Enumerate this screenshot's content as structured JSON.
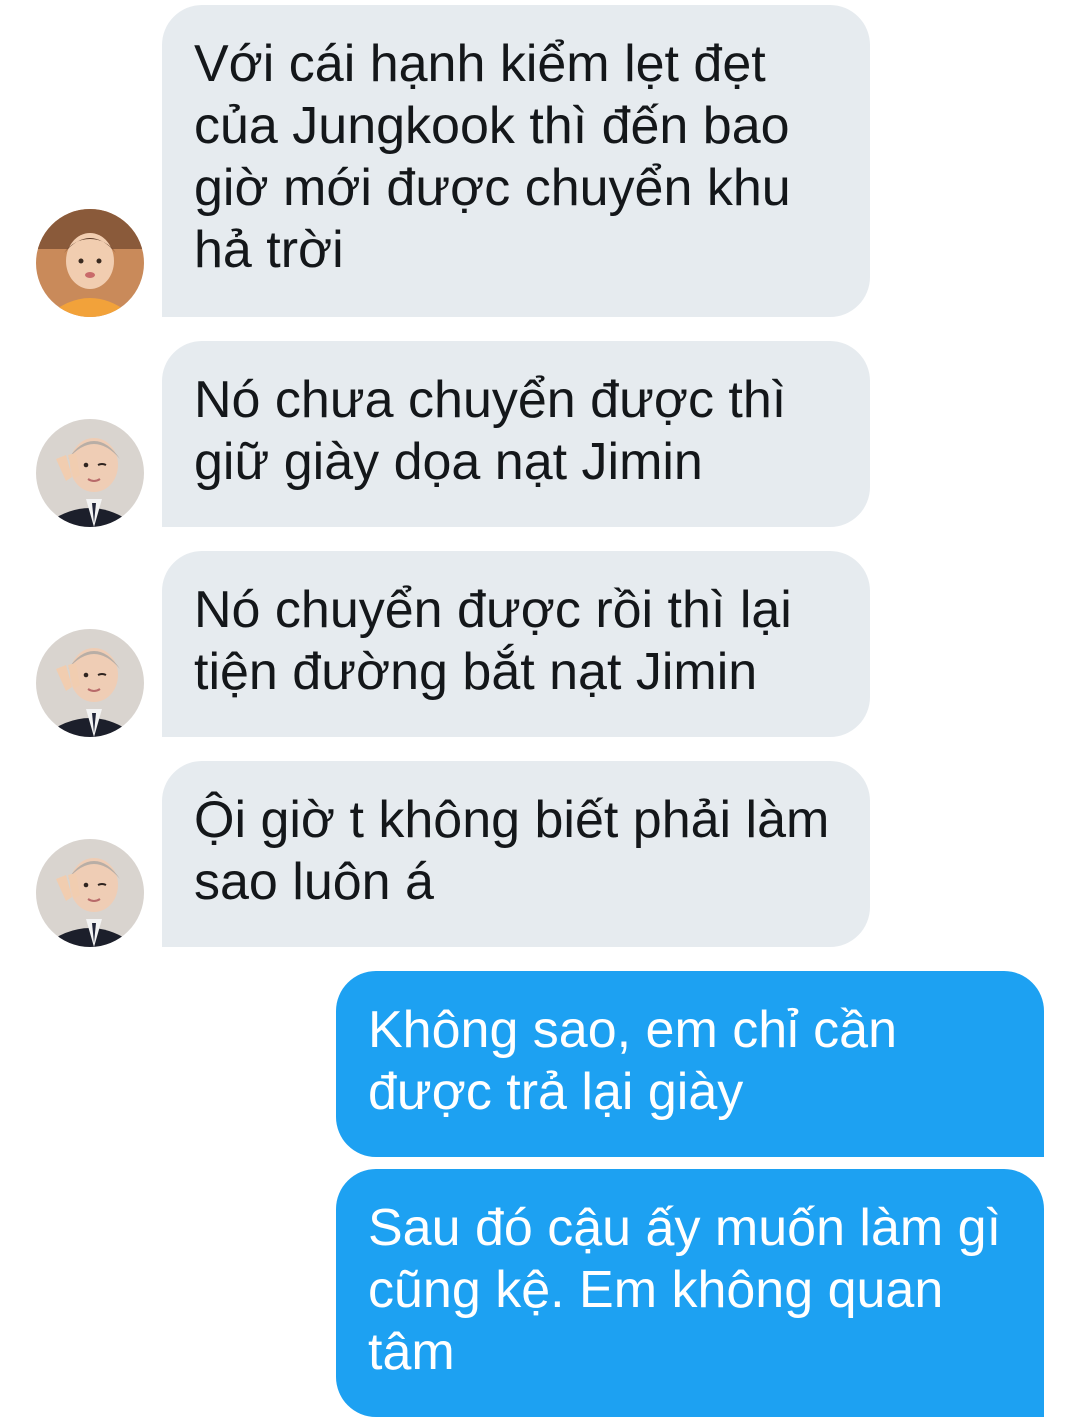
{
  "conversation": {
    "messages": [
      {
        "direction": "incoming",
        "sender_avatar": "avatar-orange-shirt",
        "text": "Với cái hạnh kiểm lẹt đẹt\ncủa Jungkook thì đến bao\ngiờ mới được chuyển khu\nhả trời"
      },
      {
        "direction": "incoming",
        "sender_avatar": "avatar-suit-peace-sign",
        "text": "Nó chưa chuyển được thì\ngiữ giày dọa nạt Jimin"
      },
      {
        "direction": "incoming",
        "sender_avatar": "avatar-suit-peace-sign",
        "text": "Nó chuyển được rồi thì lại\ntiện đường bắt nạt Jimin"
      },
      {
        "direction": "incoming",
        "sender_avatar": "avatar-suit-peace-sign",
        "text": "Ội giờ t không biết phải làm\nsao luôn á"
      },
      {
        "direction": "outgoing",
        "text": "Không sao, em chỉ cần\nđược trả lại giày"
      },
      {
        "direction": "outgoing",
        "text": "Sau đó cậu ấy muốn làm gì\ncũng kệ. Em không quan\ntâm"
      }
    ]
  },
  "colors": {
    "incoming_bubble": "#e6ebef",
    "incoming_text": "#14171a",
    "outgoing_bubble": "#1da1f2",
    "outgoing_text": "#ffffff"
  }
}
